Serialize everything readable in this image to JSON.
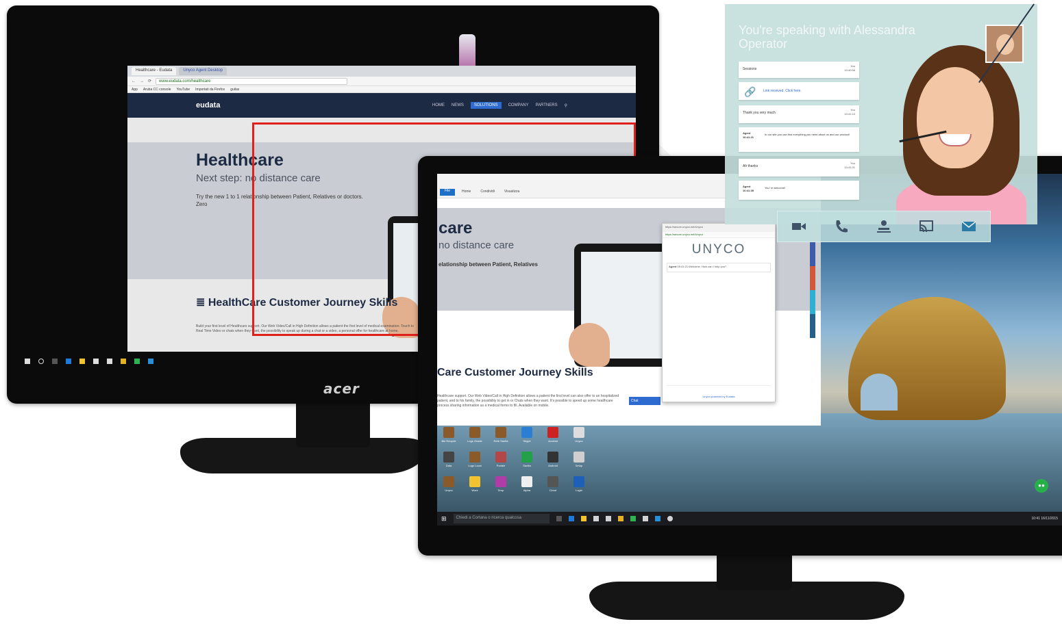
{
  "monitor_back": {
    "brand": "acer",
    "browser": {
      "tabs": [
        "Healthcare - Eudata",
        "Unyco Agent Desktop"
      ],
      "url": "www.eudata.com/healthcare",
      "bookmarks": [
        "App",
        "Aruba CC console",
        "YouTube",
        "Importati da Firefox",
        "guilas"
      ]
    },
    "site": {
      "logo": "eudata",
      "menu": [
        "HOME",
        "NEWS",
        "SOLUTIONS",
        "COMPANY",
        "PARTNERS"
      ],
      "menu_active": "SOLUTIONS",
      "hero_title": "Healthcare",
      "hero_subtitle": "Next step: no distance care",
      "hero_text": "Try the new 1 to 1 relationship between Patient, Relatives or doctors. Zero",
      "section_title": "HealthCare Customer Journey Skills",
      "body_text": "Build your first level of Healthcare support. Our Web Video/Call in High Definition allows a patient the first level of medical examination. Touch to Real Time Video or chats when they want, the possibility to speak up during a chat or a video, a personal offer for healthcare at home."
    }
  },
  "monitor_front": {
    "ribbon_tabs": [
      "Home",
      "Condividi",
      "Visualizza"
    ],
    "ribbon_file": "File",
    "site": {
      "hero_title": "care",
      "hero_subtitle": "no distance care",
      "hero_text": "elationship between Patient, Relatives",
      "section_title": "Care Customer Journey Skills",
      "body_text": "Healthcare support. Our Web Video/Call in High Definition allows a patient the first level can also offer to an hospitalized patient, and to his family, the possibility to get in or Chats when they want. It's possible to speed up some healthcare process sharing information as a medical forms to fill. Available on mobile."
    },
    "unyco_widget": {
      "logo": "UNYCO",
      "window_title": "https://secure.unyco.net/Unyco",
      "agent_label": "Agent",
      "agent_time": "09:41:21",
      "agent_message": "Welcome, How can I help you?",
      "powered": "Unyco powered by Eudata"
    },
    "chat_tab": "Chat",
    "desktop_icons": [
      "Bin Recycle",
      "Logs Oracle",
      "Rete Sanita",
      "Skype",
      "Acrobat",
      "Unyco",
      "Data",
      "Logs Local",
      "Portale",
      "Sanita",
      "Android",
      "Setup",
      "Unyco",
      "Work",
      "Drop",
      "Alpha",
      "Cloud",
      "Login"
    ],
    "search_placeholder": "Chiedi a Cortana o ricerca qualcosa",
    "tray_time": "10:41",
    "tray_date": "16/11/2015"
  },
  "chat_overlay": {
    "headline": "You're speaking with Alessandra Operator",
    "messages": [
      {
        "type": "user",
        "text": "Sessions",
        "name": "You",
        "time": "10:40:56"
      },
      {
        "type": "link",
        "text": "Link received. Click here."
      },
      {
        "type": "user",
        "text": "Thank you very much",
        "name": "You",
        "time": "10:41:10"
      },
      {
        "type": "agent",
        "name": "Agent",
        "time": "10:41:21",
        "text": "In our site you can find everything you need about us and our product!"
      },
      {
        "type": "user",
        "text": "Ah thanks",
        "name": "You",
        "time": "10:41:31"
      },
      {
        "type": "agent",
        "name": "Agent",
        "time": "10:41:35",
        "text": "You' re welcome!"
      }
    ],
    "actions": [
      "video-call",
      "phone-call",
      "cobrowse",
      "screen-share",
      "email"
    ]
  },
  "colors": {
    "accent_blue": "#2d6bd1",
    "nav_dark": "#1d2a44",
    "highlight_red": "#e0211b",
    "overlay_teal": "#c4dedc",
    "unyco_green": "#27b04a"
  }
}
